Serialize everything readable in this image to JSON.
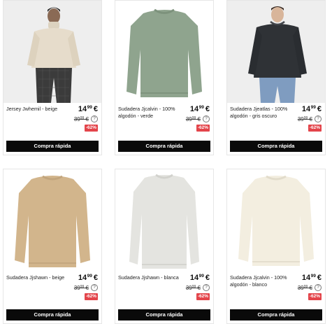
{
  "currency": "€",
  "info_symbol": "?",
  "quick_buy_label": "Compra rápida",
  "products": [
    {
      "name": "Jersey Jwhemil - beige",
      "price_int": "14",
      "price_dec": "99",
      "old_int": "39",
      "old_dec": "99",
      "discount": "-62%",
      "image": "model-turtleneck-beige",
      "colors": {
        "garment": "#e6dccb",
        "pants": "#3b3b3b",
        "bg": "#eeeeee"
      }
    },
    {
      "name": "Sudadera Jjcalvin - 100% algodón - verde",
      "price_int": "14",
      "price_dec": "99",
      "old_int": "39",
      "old_dec": "99",
      "discount": "-62%",
      "image": "sweater-green",
      "colors": {
        "garment": "#8fa48e",
        "bg": "#ffffff"
      }
    },
    {
      "name": "Sudadera Jjeatlas - 100% algodón - gris oscuro",
      "price_int": "14",
      "price_dec": "99",
      "old_int": "39",
      "old_dec": "99",
      "discount": "-62%",
      "image": "model-sweater-dark-grey",
      "colors": {
        "garment": "#2f3236",
        "pants": "#7f9cc0",
        "bg": "#eeeeee"
      }
    },
    {
      "name": "Sudadera Jjshawn - beige",
      "price_int": "14",
      "price_dec": "99",
      "old_int": "39",
      "old_dec": "99",
      "discount": "-62%",
      "image": "sweater-beige",
      "colors": {
        "garment": "#d2b58c",
        "bg": "#ffffff"
      }
    },
    {
      "name": "Sudadera Jjshawn - blanca",
      "price_int": "14",
      "price_dec": "99",
      "old_int": "39",
      "old_dec": "99",
      "discount": "-62%",
      "image": "sweater-light-grey",
      "colors": {
        "garment": "#e4e4e0",
        "bg": "#ffffff"
      }
    },
    {
      "name": "Sudadera Jjcalvin - 100% algodón - blanco",
      "price_int": "14",
      "price_dec": "99",
      "old_int": "39",
      "old_dec": "99",
      "discount": "-62%",
      "image": "sweater-cream",
      "colors": {
        "garment": "#f3eee0",
        "bg": "#ffffff"
      }
    }
  ]
}
